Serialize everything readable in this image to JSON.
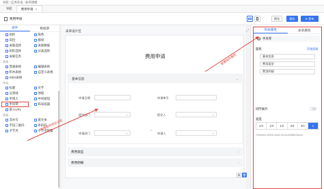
{
  "breadcrumb": {
    "home": "导航",
    "app": "应用开发",
    "page": "表单建模"
  },
  "tabs": [
    {
      "label": "导航",
      "active": false
    },
    {
      "label": "费用申请",
      "active": true
    }
  ],
  "toolbar": {
    "form_name": "费用申请",
    "devices": [
      "pc",
      "mobile"
    ],
    "preview": "预览",
    "save": "保存",
    "publish": "发布"
  },
  "left_panel": {
    "tabs": [
      "组件",
      "数据源"
    ],
    "groups": [
      {
        "items": [
          "组织",
          "角色",
          "岗位",
          "群组",
          "关联选择",
          "关联数据",
          "树形选择",
          "分类选择",
          "关联任务"
        ]
      },
      {
        "title": "表格",
        "items": [
          "普通表格",
          "编辑表格",
          "积木表格",
          "自定义表格",
          "WBS表格"
        ]
      },
      {
        "title": "布局",
        "items": [
          "标题",
          "文字",
          "分割线",
          "弹窗",
          "折叠面板",
          "布局容器"
        ]
      },
      {
        "title": "",
        "items": [
          "申请人",
          "中间按钮",
          "手风琴",
          "嵌入URL"
        ]
      },
      {
        "title": "高级",
        "items": [
          "流水号",
          "富文本",
          "字段二维码",
          "条形码",
          "子节点",
          "子节点配置"
        ]
      }
    ]
  },
  "canvas": {
    "title": "表单设计区",
    "form_title": "费用申请",
    "groups": [
      {
        "label": "基本信息",
        "fields": [
          {
            "label": "申请日期",
            "value": ""
          },
          {
            "label": "申请单号",
            "value": ""
          },
          {
            "label": "提交部门",
            "value": ""
          },
          {
            "label": "提交人",
            "value": ""
          },
          {
            "label": "申请部门",
            "value": ""
          },
          {
            "label": "申请人",
            "value": ""
          }
        ]
      },
      {
        "label": "费用类型"
      },
      {
        "label": "费用明细"
      }
    ]
  },
  "right_panel": {
    "tabs": [
      "布局属性",
      "表单属性"
    ],
    "component": "手风琴",
    "panels_label": "面板",
    "add_panel": "添加面板",
    "panels": [
      "基本信息",
      "费用类型",
      "费用明细"
    ],
    "accordion_label": "同时展开",
    "accordion_on": false,
    "width_label": "宽度",
    "width_options": [
      "1/4",
      "1/3",
      "1/2",
      "2/3",
      "3/4",
      "1"
    ],
    "width_selected": "1",
    "component_id": "7d9eeee-00bb-4662-8c2a-8288d3aced"
  },
  "annotations": {
    "left": "拖拽组件到设计区",
    "right": "配置组件属性"
  }
}
